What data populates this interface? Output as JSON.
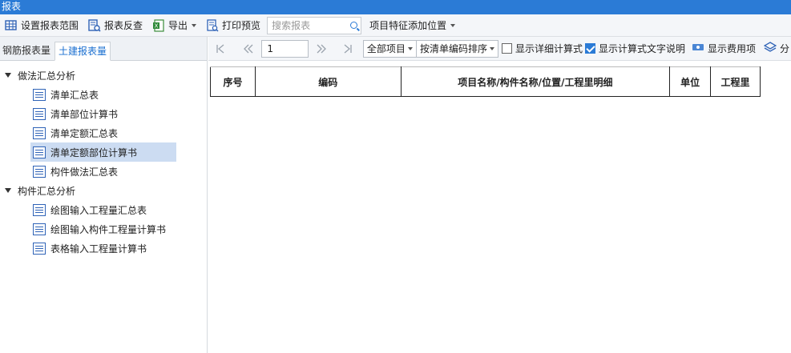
{
  "window": {
    "title": "报表"
  },
  "toolbar": {
    "set_range": "设置报表范围",
    "report_check": "报表反查",
    "export": "导出",
    "print_preview": "打印预览",
    "search_placeholder": "搜索报表",
    "feature_position": "项目特征添加位置"
  },
  "tabs": [
    {
      "label": "钢筋报表量",
      "active": false
    },
    {
      "label": "土建报表量",
      "active": true
    }
  ],
  "tree": {
    "group1": {
      "label": "做法汇总分析"
    },
    "group1_items": [
      {
        "label": "清单汇总表"
      },
      {
        "label": "清单部位计算书"
      },
      {
        "label": "清单定额汇总表"
      },
      {
        "label": "清单定额部位计算书",
        "selected": true
      },
      {
        "label": "构件做法汇总表"
      }
    ],
    "group2": {
      "label": "构件汇总分析"
    },
    "group2_items": [
      {
        "label": "绘图输入工程量汇总表"
      },
      {
        "label": "绘图输入构件工程量计算书"
      },
      {
        "label": "表格输入工程量计算书"
      }
    ]
  },
  "nav": {
    "page": "1",
    "filter": "全部项目",
    "sort": "按清单编码排序",
    "show_detail": "显示详细计算式",
    "show_detail_checked": false,
    "show_text_desc": "显示计算式文字说明",
    "show_text_desc_checked": true,
    "show_cost": "显示费用项",
    "cut_off": "分"
  },
  "table": {
    "columns": [
      "序号",
      "编码",
      "项目名称/构件名称/位置/工程里明细",
      "单位",
      "工程里"
    ]
  },
  "colors": {
    "titlebar": "#2b7bd6",
    "selected": "#ccdcf2",
    "accent": "#1a6fd0"
  }
}
